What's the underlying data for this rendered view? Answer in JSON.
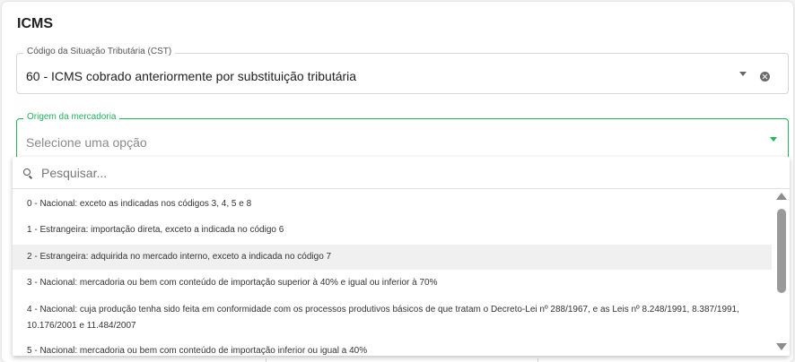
{
  "section": {
    "title": "ICMS"
  },
  "cst_field": {
    "label": "Código da Situação Tributária (CST)",
    "value": "60 - ICMS cobrado anteriormente por substituição tributária"
  },
  "origem_field": {
    "label": "Origem da mercadoria",
    "placeholder": "Selecione uma opção",
    "accent_color": "#21b35a"
  },
  "dropdown": {
    "search_placeholder": "Pesquisar...",
    "options": [
      {
        "label": "0 - Nacional: exceto as indicadas nos códigos 3, 4, 5 e 8"
      },
      {
        "label": "1 - Estrangeira: importação direta, exceto a indicada no código 6"
      },
      {
        "label": "2 - Estrangeira: adquirida no mercado interno, exceto a indicada no código 7"
      },
      {
        "label": "3 - Nacional: mercadoria ou bem com conteúdo de importação superior à 40% e igual ou inferior à 70%"
      },
      {
        "label": "4 - Nacional: cuja produção tenha sido feita em conformidade com os processos produtivos básicos de que tratam o Decreto-Lei nº 288/1967, e as Leis nº 8.248/1991, 8.387/1991, 10.176/2001 e 11.484/2007"
      },
      {
        "label": "5 - Nacional: mercadoria ou bem com conteúdo de importação inferior ou igual a 40%"
      }
    ],
    "highlighted_index": 2
  }
}
